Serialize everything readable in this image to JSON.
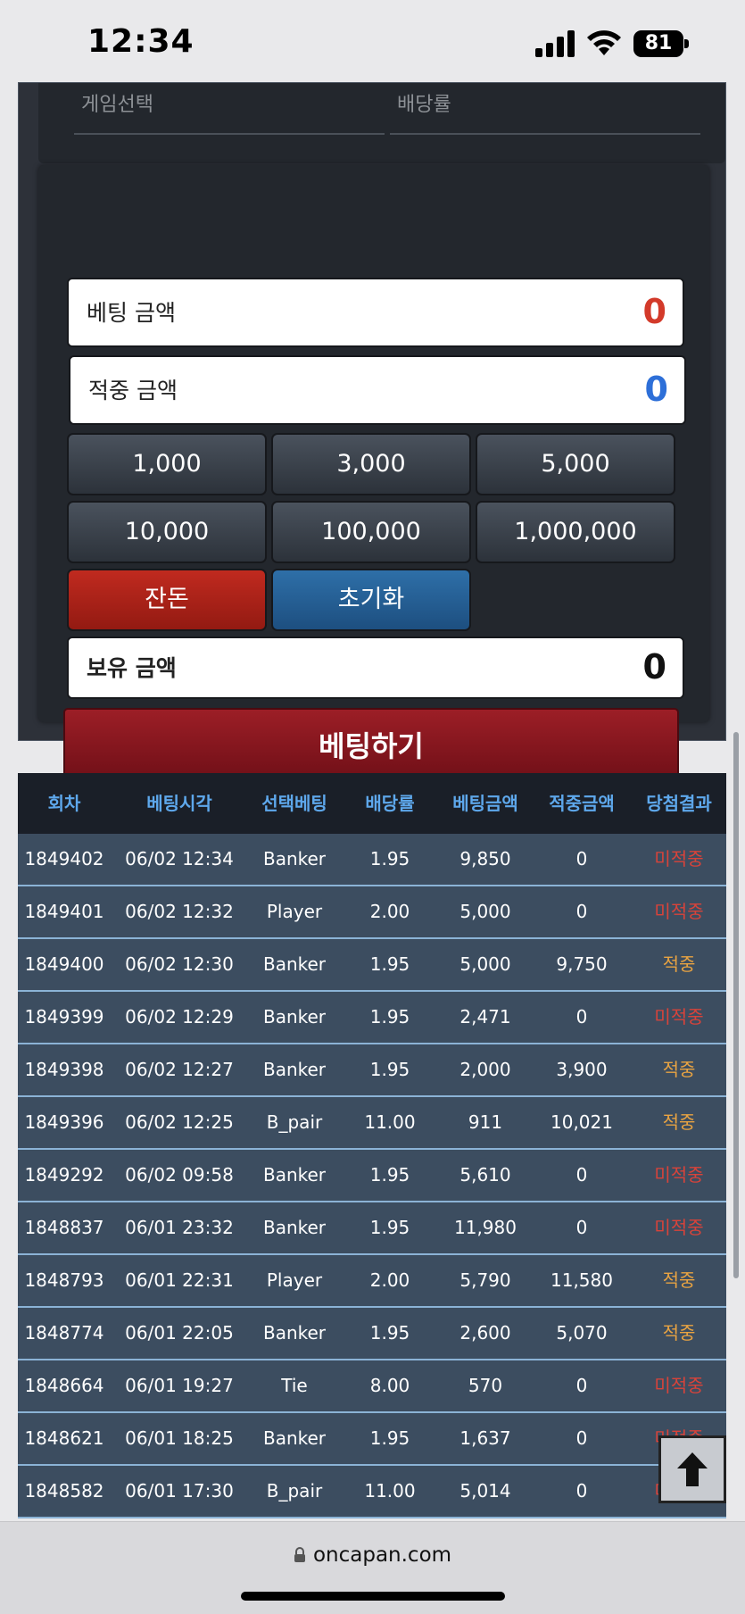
{
  "status": {
    "time": "12:34",
    "battery": "81"
  },
  "form": {
    "game_select_label": "게임선택",
    "odds_label": "배당률",
    "bet_amount_label": "베팅 금액",
    "bet_amount_value": "0",
    "win_amount_label": "적중 금액",
    "win_amount_value": "0",
    "chips": [
      "1,000",
      "3,000",
      "5,000",
      "10,000",
      "100,000",
      "1,000,000"
    ],
    "balance_button": "잔돈",
    "reset_button": "초기화",
    "holding_label": "보유 금액",
    "holding_value": "0",
    "submit_button": "베팅하기"
  },
  "history": {
    "headers": [
      "회차",
      "베팅시각",
      "선택베팅",
      "배당률",
      "베팅금액",
      "적중금액",
      "당첨결과"
    ],
    "rows": [
      [
        "1849402",
        "06/02 12:34",
        "Banker",
        "1.95",
        "9,850",
        "0",
        "미적중"
      ],
      [
        "1849401",
        "06/02 12:32",
        "Player",
        "2.00",
        "5,000",
        "0",
        "미적중"
      ],
      [
        "1849400",
        "06/02 12:30",
        "Banker",
        "1.95",
        "5,000",
        "9,750",
        "적중"
      ],
      [
        "1849399",
        "06/02 12:29",
        "Banker",
        "1.95",
        "2,471",
        "0",
        "미적중"
      ],
      [
        "1849398",
        "06/02 12:27",
        "Banker",
        "1.95",
        "2,000",
        "3,900",
        "적중"
      ],
      [
        "1849396",
        "06/02 12:25",
        "B_pair",
        "11.00",
        "911",
        "10,021",
        "적중"
      ],
      [
        "1849292",
        "06/02 09:58",
        "Banker",
        "1.95",
        "5,610",
        "0",
        "미적중"
      ],
      [
        "1848837",
        "06/01 23:32",
        "Banker",
        "1.95",
        "11,980",
        "0",
        "미적중"
      ],
      [
        "1848793",
        "06/01 22:31",
        "Player",
        "2.00",
        "5,790",
        "11,580",
        "적중"
      ],
      [
        "1848774",
        "06/01 22:05",
        "Banker",
        "1.95",
        "2,600",
        "5,070",
        "적중"
      ],
      [
        "1848664",
        "06/01 19:27",
        "Tie",
        "8.00",
        "570",
        "0",
        "미적중"
      ],
      [
        "1848621",
        "06/01 18:25",
        "Banker",
        "1.95",
        "1,637",
        "0",
        "미적중"
      ],
      [
        "1848582",
        "06/01 17:30",
        "B_pair",
        "11.00",
        "5,014",
        "0",
        "미적중"
      ]
    ]
  },
  "colors": {
    "miss": "#d8433a",
    "hit": "#e8a342",
    "header_text": "#5ea8ec",
    "row_bg": "#3c4d60"
  },
  "browser": {
    "url": "oncapan.com"
  }
}
